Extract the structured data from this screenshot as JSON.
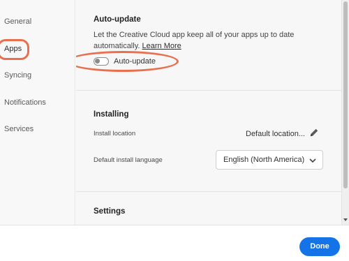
{
  "sidebar": {
    "items": [
      {
        "label": "General",
        "active": false
      },
      {
        "label": "Apps",
        "active": true
      },
      {
        "label": "Syncing",
        "active": false
      },
      {
        "label": "Notifications",
        "active": false
      },
      {
        "label": "Services",
        "active": false
      }
    ]
  },
  "auto_update": {
    "title": "Auto-update",
    "description": "Let the Creative Cloud app keep all of your apps up to date automatically.",
    "link": "Learn More",
    "toggle_label": "Auto-update",
    "toggle_state": "off"
  },
  "installing": {
    "title": "Installing",
    "location_label": "Install location",
    "location_value": "Default location...",
    "language_label": "Default install language",
    "language_value": "English (North America)"
  },
  "settings": {
    "title": "Settings",
    "checkbox_checked": true
  },
  "footer": {
    "done_label": "Done"
  },
  "colors": {
    "highlight": "#e8704f",
    "accent": "#1473e6",
    "checkbox": "#2f78d9"
  },
  "icons": [
    "pencil-icon",
    "chevron-down-icon",
    "scroll-down-arrow-icon"
  ]
}
